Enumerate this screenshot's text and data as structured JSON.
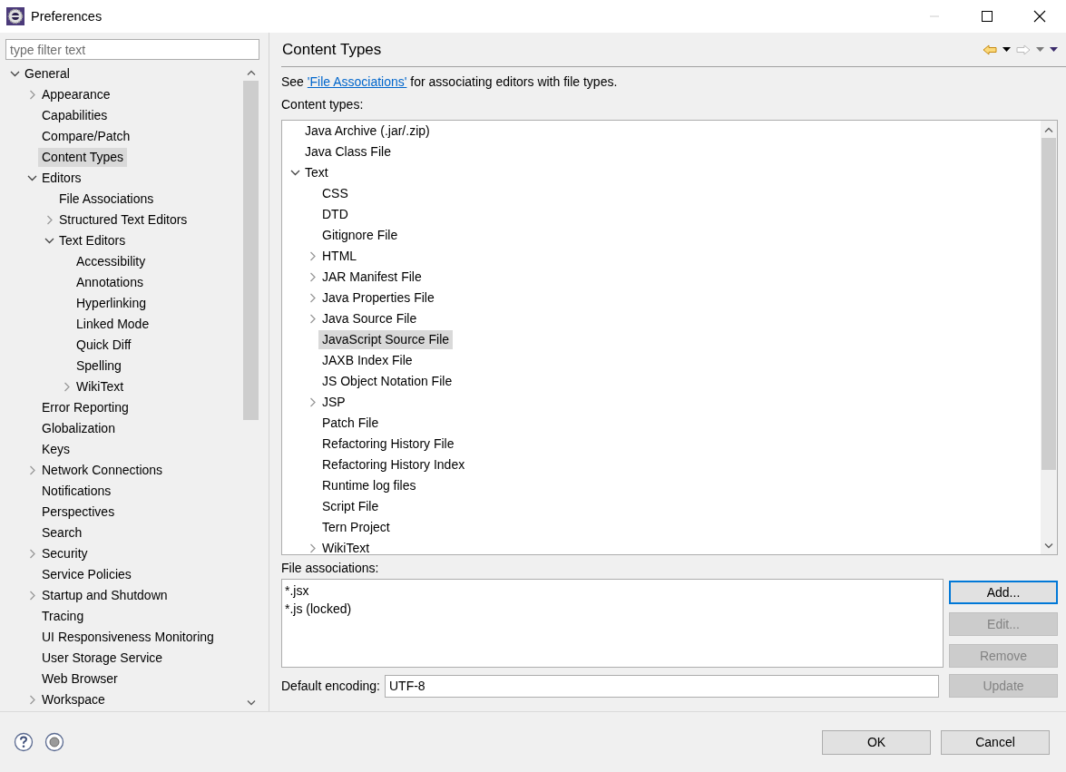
{
  "window": {
    "title": "Preferences"
  },
  "sidebar": {
    "filter": {
      "placeholder": "type filter text"
    },
    "items": [
      {
        "label": "General",
        "expanded": true,
        "selected": false,
        "children": [
          {
            "label": "Appearance",
            "expanded": false,
            "selected": false
          },
          {
            "label": "Capabilities",
            "selected": false
          },
          {
            "label": "Compare/Patch",
            "selected": false
          },
          {
            "label": "Content Types",
            "selected": true
          },
          {
            "label": "Editors",
            "expanded": true,
            "selected": false,
            "children": [
              {
                "label": "File Associations",
                "selected": false
              },
              {
                "label": "Structured Text Editors",
                "expanded": false,
                "selected": false
              },
              {
                "label": "Text Editors",
                "expanded": true,
                "selected": false,
                "children": [
                  {
                    "label": "Accessibility",
                    "selected": false
                  },
                  {
                    "label": "Annotations",
                    "selected": false
                  },
                  {
                    "label": "Hyperlinking",
                    "selected": false
                  },
                  {
                    "label": "Linked Mode",
                    "selected": false
                  },
                  {
                    "label": "Quick Diff",
                    "selected": false
                  },
                  {
                    "label": "Spelling",
                    "selected": false
                  },
                  {
                    "label": "WikiText",
                    "expanded": false,
                    "selected": false
                  }
                ]
              }
            ]
          },
          {
            "label": "Error Reporting",
            "selected": false
          },
          {
            "label": "Globalization",
            "selected": false
          },
          {
            "label": "Keys",
            "selected": false
          },
          {
            "label": "Network Connections",
            "expanded": false,
            "selected": false
          },
          {
            "label": "Notifications",
            "selected": false
          },
          {
            "label": "Perspectives",
            "selected": false
          },
          {
            "label": "Search",
            "selected": false
          },
          {
            "label": "Security",
            "expanded": false,
            "selected": false
          },
          {
            "label": "Service Policies",
            "selected": false
          },
          {
            "label": "Startup and Shutdown",
            "expanded": false,
            "selected": false
          },
          {
            "label": "Tracing",
            "selected": false
          },
          {
            "label": "UI Responsiveness Monitoring",
            "selected": false
          },
          {
            "label": "User Storage Service",
            "selected": false
          },
          {
            "label": "Web Browser",
            "selected": false
          },
          {
            "label": "Workspace",
            "expanded": false,
            "selected": false
          }
        ]
      }
    ]
  },
  "page": {
    "title": "Content Types",
    "intro": {
      "before": "See ",
      "link": "'File Associations'",
      "after": " for associating editors with file types."
    },
    "content_types_label": "Content types:",
    "content_types": [
      {
        "label": "Java Archive (.jar/.zip)",
        "selected": false
      },
      {
        "label": "Java Class File",
        "selected": false
      },
      {
        "label": "Text",
        "expanded": true,
        "selected": false,
        "children": [
          {
            "label": "CSS",
            "selected": false
          },
          {
            "label": "DTD",
            "selected": false
          },
          {
            "label": "Gitignore File",
            "selected": false
          },
          {
            "label": "HTML",
            "expanded": false,
            "selected": false
          },
          {
            "label": "JAR Manifest File",
            "expanded": false,
            "selected": false
          },
          {
            "label": "Java Properties File",
            "expanded": false,
            "selected": false
          },
          {
            "label": "Java Source File",
            "expanded": false,
            "selected": false
          },
          {
            "label": "JavaScript Source File",
            "selected": true
          },
          {
            "label": "JAXB Index File",
            "selected": false
          },
          {
            "label": "JS Object Notation File",
            "selected": false
          },
          {
            "label": "JSP",
            "expanded": false,
            "selected": false
          },
          {
            "label": "Patch File",
            "selected": false
          },
          {
            "label": "Refactoring History File",
            "selected": false
          },
          {
            "label": "Refactoring History Index",
            "selected": false
          },
          {
            "label": "Runtime log files",
            "selected": false
          },
          {
            "label": "Script File",
            "selected": false
          },
          {
            "label": "Tern Project",
            "selected": false
          },
          {
            "label": "WikiText",
            "expanded": false,
            "selected": false
          }
        ]
      }
    ],
    "file_associations_label": "File associations:",
    "file_associations": [
      "*.jsx",
      "*.js (locked)"
    ],
    "buttons": [
      {
        "label": "Add...",
        "disabled": false,
        "default": true
      },
      {
        "label": "Edit...",
        "disabled": true,
        "default": false
      },
      {
        "label": "Remove",
        "disabled": true,
        "default": false
      },
      {
        "label": "Update",
        "disabled": true,
        "default": false
      }
    ],
    "encoding": {
      "label": "Default encoding:",
      "value": "UTF-8"
    }
  },
  "footer": {
    "buttons": [
      {
        "label": "OK"
      },
      {
        "label": "Cancel"
      }
    ]
  }
}
